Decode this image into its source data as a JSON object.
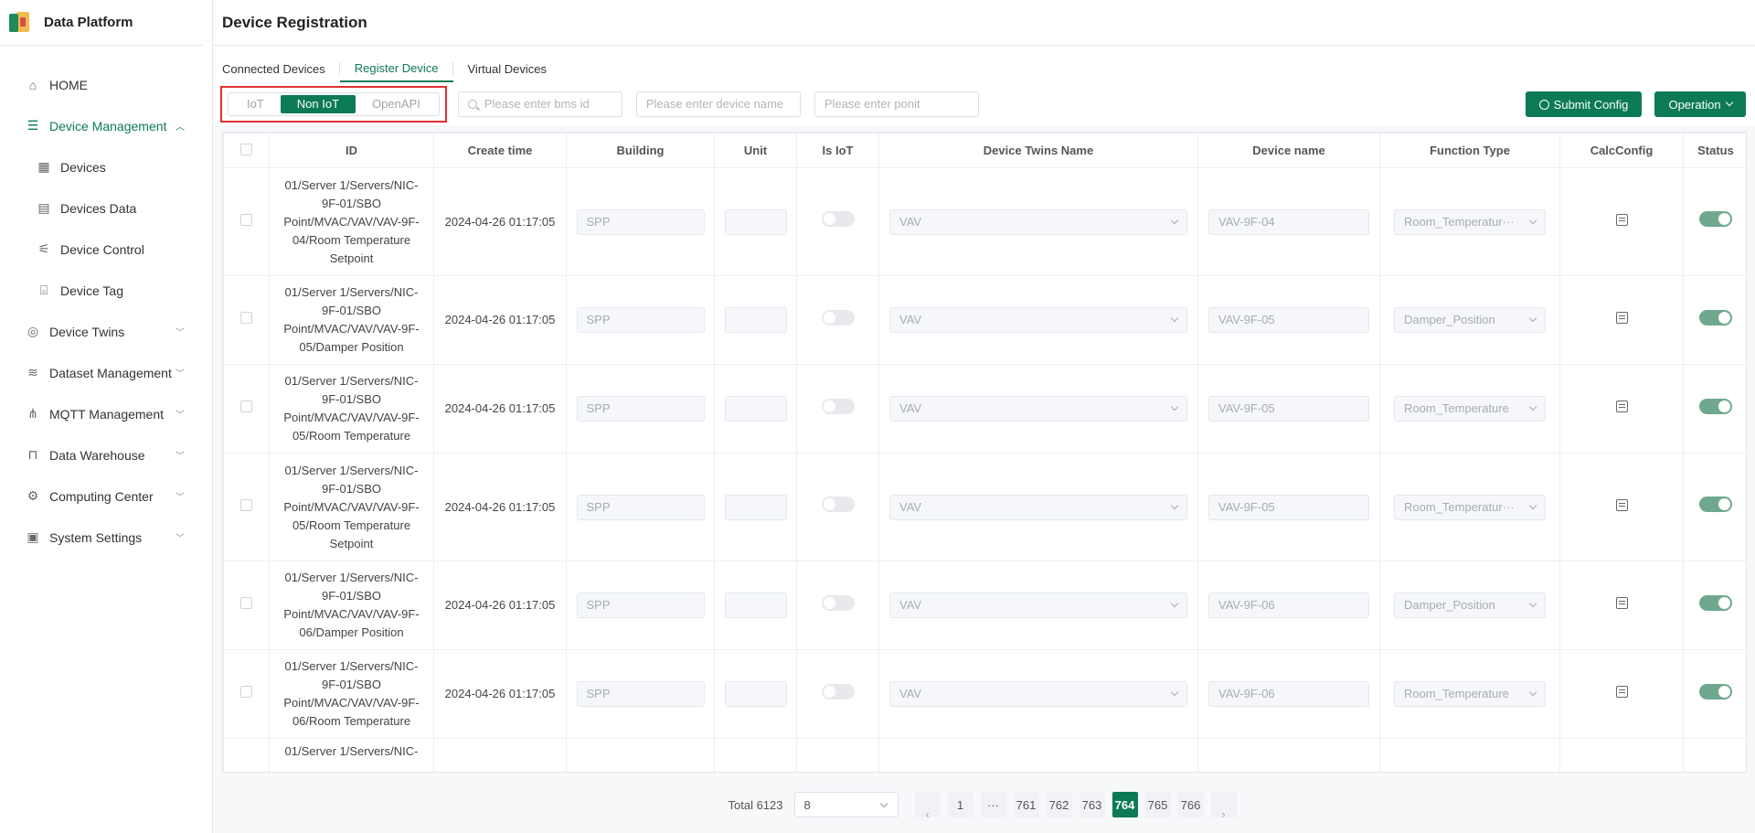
{
  "app": {
    "name": "Data Platform"
  },
  "sidebar": {
    "items": [
      {
        "label": "HOME",
        "icon": "home-icon",
        "type": "top",
        "active": false,
        "expandable": false
      },
      {
        "label": "Device Management",
        "icon": "server-icon",
        "type": "top",
        "active": true,
        "expandable": true,
        "expanded": true
      },
      {
        "label": "Devices",
        "icon": "building-icon",
        "type": "sub"
      },
      {
        "label": "Devices Data",
        "icon": "chart-doc-icon",
        "type": "sub"
      },
      {
        "label": "Device Control",
        "icon": "sliders-icon",
        "type": "sub"
      },
      {
        "label": "Device Tag",
        "icon": "tag-icon",
        "type": "sub"
      },
      {
        "label": "Device Twins",
        "icon": "globe-icon",
        "type": "top",
        "expandable": true
      },
      {
        "label": "Dataset Management",
        "icon": "database-icon",
        "type": "top",
        "expandable": true
      },
      {
        "label": "MQTT Management",
        "icon": "network-icon",
        "type": "top",
        "expandable": true
      },
      {
        "label": "Data Warehouse",
        "icon": "easel-icon",
        "type": "top",
        "expandable": true
      },
      {
        "label": "Computing Center",
        "icon": "cogs-icon",
        "type": "top",
        "expandable": true
      },
      {
        "label": "System Settings",
        "icon": "monitor-icon",
        "type": "top",
        "expandable": true
      }
    ]
  },
  "header": {
    "title": "Device Registration"
  },
  "tabs": [
    {
      "label": "Connected Devices",
      "active": false
    },
    {
      "label": "Register Device",
      "active": true
    },
    {
      "label": "Virtual Devices",
      "active": false
    }
  ],
  "toolbar": {
    "segments": [
      {
        "label": "IoT",
        "active": false
      },
      {
        "label": "Non IoT",
        "active": true
      },
      {
        "label": "OpenAPI",
        "active": false
      }
    ],
    "bms_placeholder": "Please enter bms id",
    "device_name_placeholder": "Please enter device name",
    "ponit_placeholder": "Please enter ponit",
    "submit_label": "Submit Config",
    "operation_label": "Operation"
  },
  "table": {
    "columns": [
      "ID",
      "Create time",
      "Building",
      "Unit",
      "Is IoT",
      "Device Twins Name",
      "Device name",
      "Function Type",
      "CalcConfig",
      "Status"
    ],
    "rows": [
      {
        "id": "01/Server 1/Servers/NIC-9F-01/SBO Point/MVAC/VAV/VAV-9F-04/Room Temperature Setpoint",
        "create_time": "2024-04-26 01:17:05",
        "building": "SPP",
        "unit": "",
        "is_iot": false,
        "twins": "VAV",
        "device_name": "VAV-9F-04",
        "function_type": "Room_Temperatur···",
        "status": true
      },
      {
        "id": "01/Server 1/Servers/NIC-9F-01/SBO Point/MVAC/VAV/VAV-9F-05/Damper Position",
        "create_time": "2024-04-26 01:17:05",
        "building": "SPP",
        "unit": "",
        "is_iot": false,
        "twins": "VAV",
        "device_name": "VAV-9F-05",
        "function_type": "Damper_Position",
        "status": true
      },
      {
        "id": "01/Server 1/Servers/NIC-9F-01/SBO Point/MVAC/VAV/VAV-9F-05/Room Temperature",
        "create_time": "2024-04-26 01:17:05",
        "building": "SPP",
        "unit": "",
        "is_iot": false,
        "twins": "VAV",
        "device_name": "VAV-9F-05",
        "function_type": "Room_Temperature",
        "status": true
      },
      {
        "id": "01/Server 1/Servers/NIC-9F-01/SBO Point/MVAC/VAV/VAV-9F-05/Room Temperature Setpoint",
        "create_time": "2024-04-26 01:17:05",
        "building": "SPP",
        "unit": "",
        "is_iot": false,
        "twins": "VAV",
        "device_name": "VAV-9F-05",
        "function_type": "Room_Temperatur···",
        "status": true
      },
      {
        "id": "01/Server 1/Servers/NIC-9F-01/SBO Point/MVAC/VAV/VAV-9F-06/Damper Position",
        "create_time": "2024-04-26 01:17:05",
        "building": "SPP",
        "unit": "",
        "is_iot": false,
        "twins": "VAV",
        "device_name": "VAV-9F-06",
        "function_type": "Damper_Position",
        "status": true
      },
      {
        "id": "01/Server 1/Servers/NIC-9F-01/SBO Point/MVAC/VAV/VAV-9F-06/Room Temperature",
        "create_time": "2024-04-26 01:17:05",
        "building": "SPP",
        "unit": "",
        "is_iot": false,
        "twins": "VAV",
        "device_name": "VAV-9F-06",
        "function_type": "Room_Temperature",
        "status": true
      },
      {
        "id": "01/Server 1/Servers/NIC-",
        "create_time": "",
        "building": "",
        "unit": "",
        "is_iot": null,
        "twins": "",
        "device_name": "",
        "function_type": "",
        "status": null
      }
    ]
  },
  "pagination": {
    "total_label": "Total 6123",
    "page_size": "8",
    "pages": [
      "1",
      "···",
      "761",
      "762",
      "763",
      "764",
      "765",
      "766"
    ],
    "current": "764",
    "prev": "‹",
    "next": "›"
  },
  "colors": {
    "accent": "#0c7a55",
    "highlight_border": "#e03030"
  }
}
